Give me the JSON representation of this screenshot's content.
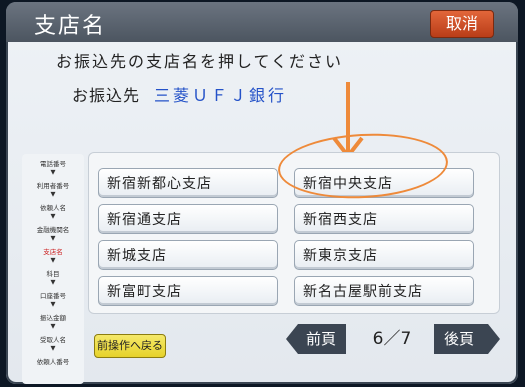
{
  "header": {
    "title": "支店名",
    "cancel_label": "取消"
  },
  "instruction": "お振込先の支店名を押してください",
  "destination": {
    "label": "お振込先",
    "bank": "三菱ＵＦＪ銀行"
  },
  "steps": [
    {
      "label": "電話番号",
      "active": false
    },
    {
      "label": "利用者番号",
      "active": false
    },
    {
      "label": "依頼人名",
      "active": false
    },
    {
      "label": "金融機関名",
      "active": false
    },
    {
      "label": "支店名",
      "active": true
    },
    {
      "label": "科目",
      "active": false
    },
    {
      "label": "口座番号",
      "active": false
    },
    {
      "label": "振込金額",
      "active": false
    },
    {
      "label": "受取人名",
      "active": false
    },
    {
      "label": "依頼人番号",
      "active": false
    }
  ],
  "branches": [
    "新宿新都心支店",
    "新宿中央支店",
    "新宿通支店",
    "新宿西支店",
    "新城支店",
    "新東京支店",
    "新富町支店",
    "新名古屋駅前支店"
  ],
  "nav": {
    "back_label": "前操作へ戻る",
    "prev_label": "前頁",
    "page": "6／7",
    "next_label": "後頁"
  },
  "colors": {
    "cancel": "#d2542a",
    "bank_text": "#2452c8",
    "highlight": "#ee8a3a",
    "back_button": "#efe14a"
  }
}
